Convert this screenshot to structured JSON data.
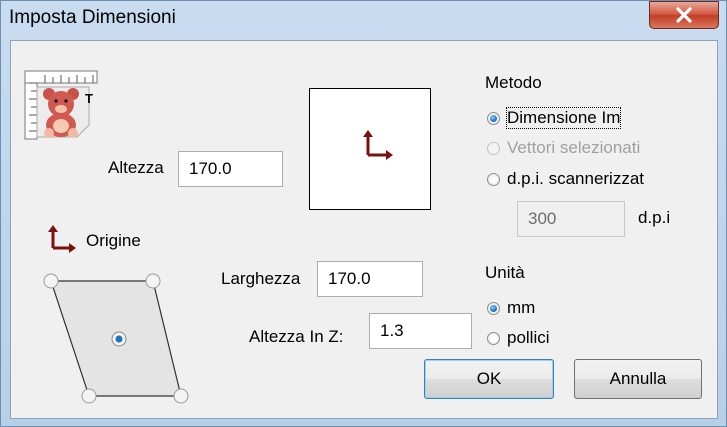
{
  "window": {
    "title": "Imposta Dimensioni"
  },
  "form": {
    "altezza_label": "Altezza",
    "altezza_value": "170.0",
    "origine_label": "Origine",
    "larghezza_label": "Larghezza",
    "larghezza_value": "170.0",
    "altezza_z_label": "Altezza In Z:",
    "altezza_z_value": "1.3"
  },
  "metodo": {
    "group_label": "Metodo",
    "options": [
      {
        "label": "Dimensione Im",
        "checked": true,
        "enabled": true
      },
      {
        "label": "Vettori selezionati",
        "checked": false,
        "enabled": false
      },
      {
        "label": "d.p.i. scannerizzat",
        "checked": false,
        "enabled": true
      }
    ],
    "dpi_value": "300",
    "dpi_unit": "d.p.i"
  },
  "unita": {
    "group_label": "Unità",
    "options": [
      {
        "label": "mm",
        "checked": true
      },
      {
        "label": "pollici",
        "checked": false
      }
    ]
  },
  "buttons": {
    "ok": "OK",
    "cancel": "Annulla"
  },
  "colors": {
    "arrow": "#7a1010",
    "accent": "#1d74c2"
  },
  "icons": {
    "app": "teddy-bear-ruler-icon",
    "origin": "origin-arrow-icon",
    "close": "close-icon"
  }
}
